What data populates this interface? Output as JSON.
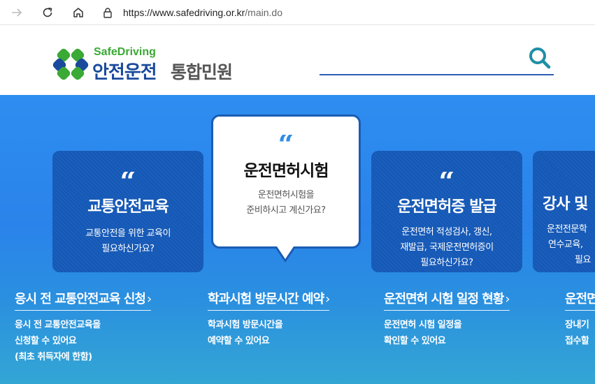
{
  "browser": {
    "url_main": "https://www.safedriving.or.kr",
    "url_path": "/main.do"
  },
  "header": {
    "logo_sub": "SafeDriving",
    "logo_main": "안전운전",
    "logo_main2": "통합민원",
    "brand_green": "#3aa935",
    "brand_blue": "#1a4a9c"
  },
  "cards": [
    {
      "title": "교통안전교육",
      "desc1": "교통안전을 위한 교육이",
      "desc2": "필요하신가요?"
    },
    {
      "title": "운전면허시험",
      "desc1": "운전면허시험을",
      "desc2": "준비하시고 계신가요?"
    },
    {
      "title": "운전면허증 발급",
      "desc1": "운전면허 적성검사, 갱신,",
      "desc2": "재발급, 국제운전면허증이",
      "desc3": "필요하신가요?"
    },
    {
      "title": "강사 및",
      "desc1": "운전전문학",
      "desc2": "연수교육,",
      "desc3": "필요"
    }
  ],
  "links": [
    {
      "title": "응시 전 교통안전교육 신청",
      "desc1": "응시 전 교통안전교육을",
      "desc2": "신청할 수 있어요",
      "desc3": "(최초 취득자에 한함)"
    },
    {
      "title": "학과시험 방문시간 예약",
      "desc1": "학과시험 방문시간을",
      "desc2": "예약할 수 있어요"
    },
    {
      "title": "운전면허 시험 일정 현황",
      "desc1": "운전면허 시험 일정을",
      "desc2": "확인할 수 있어요"
    },
    {
      "title": "운전면",
      "desc1": "장내기",
      "desc2": "접수할"
    }
  ],
  "quote_mark": "“",
  "chevron": "›"
}
